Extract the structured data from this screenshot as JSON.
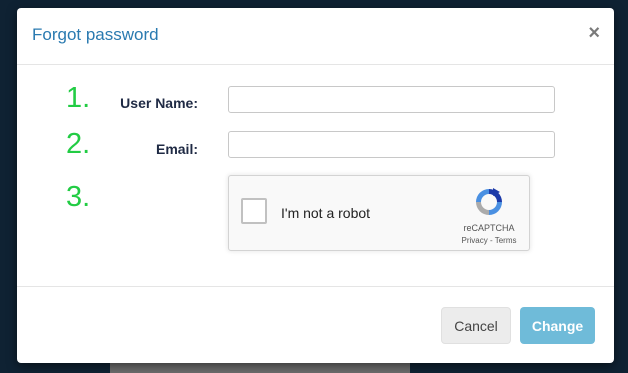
{
  "modal": {
    "title": "Forgot password",
    "close_label": "×"
  },
  "steps": [
    "1.",
    "2.",
    "3."
  ],
  "form": {
    "username_label": "User Name:",
    "username_value": "",
    "email_label": "Email:",
    "email_value": ""
  },
  "recaptcha": {
    "label": "I'm not a robot",
    "brand": "reCAPTCHA",
    "links": "Privacy - Terms"
  },
  "footer": {
    "cancel_label": "Cancel",
    "change_label": "Change"
  },
  "colors": {
    "title": "#2a7ab0",
    "step_numbers": "#22cc44",
    "change_button": "#6fbbd9",
    "overlay": "#0f2233"
  }
}
